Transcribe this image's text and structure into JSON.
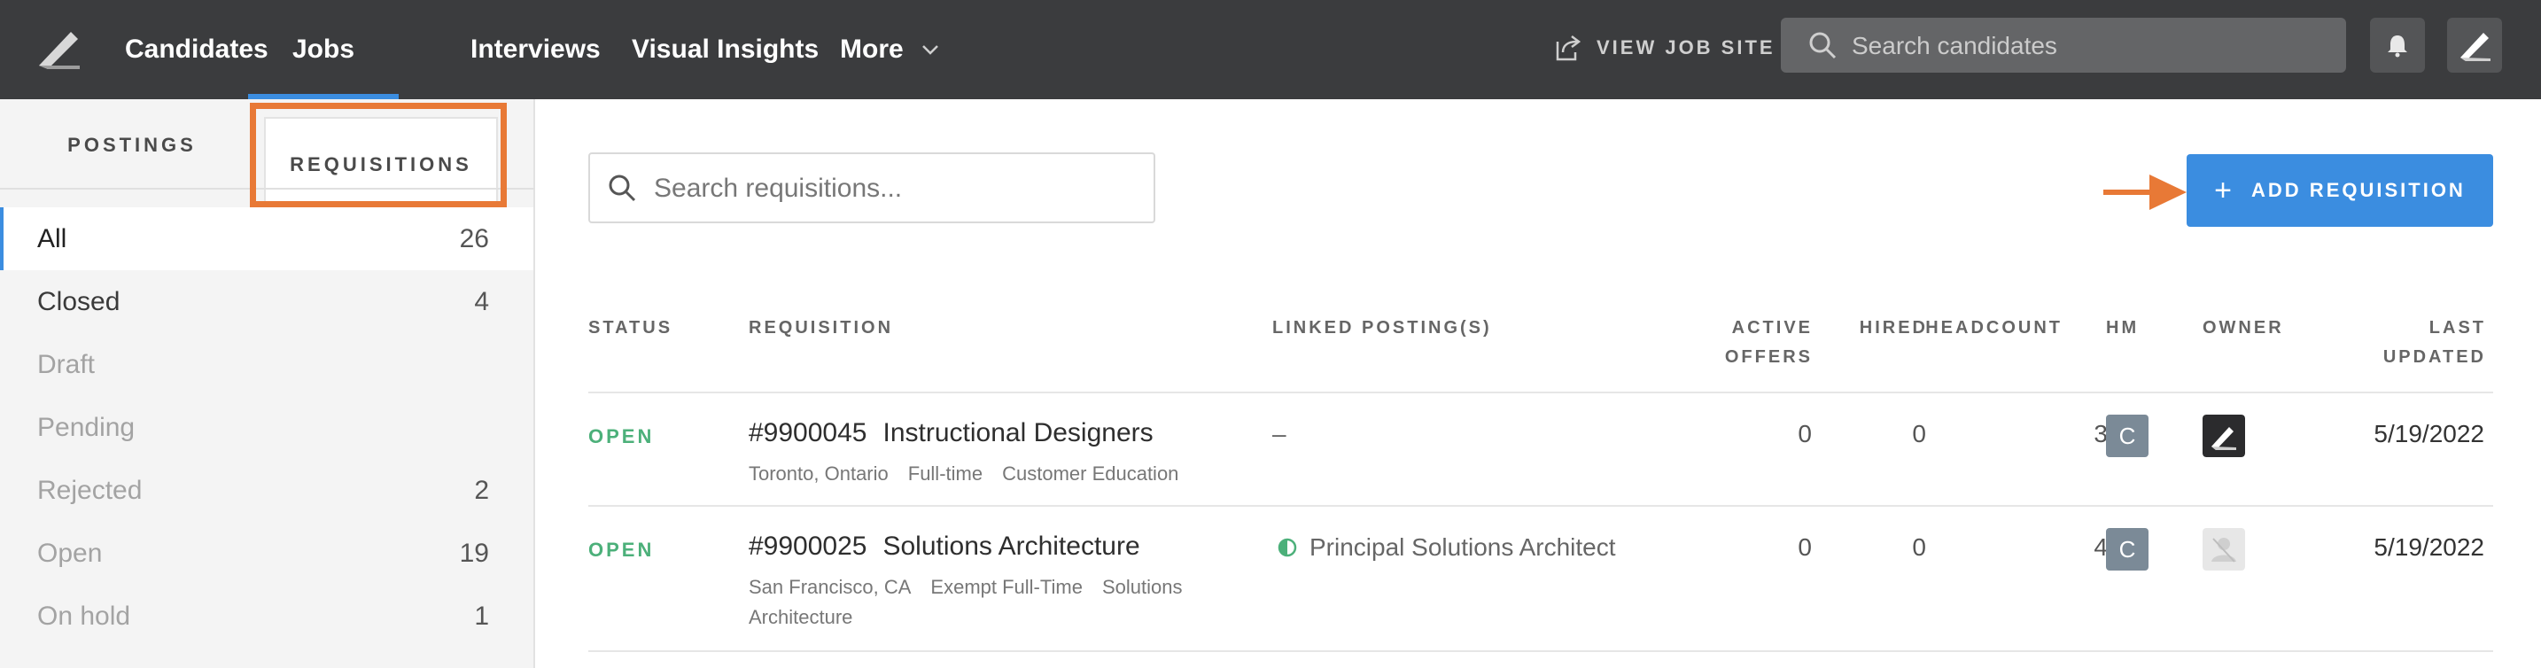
{
  "nav": {
    "items": [
      {
        "label": "Candidates"
      },
      {
        "label": "Jobs"
      },
      {
        "label": "Interviews"
      },
      {
        "label": "Visual Insights"
      },
      {
        "label": "More"
      }
    ],
    "active_item": "Jobs",
    "view_job_site": "VIEW JOB SITE",
    "search_placeholder": "Search candidates"
  },
  "sidebar": {
    "tabs": [
      {
        "label": "POSTINGS"
      },
      {
        "label": "REQUISITIONS"
      }
    ],
    "active_tab": "REQUISITIONS",
    "filters": [
      {
        "label": "All",
        "count": "26"
      },
      {
        "label": "Closed",
        "count": "4"
      },
      {
        "label": "Draft",
        "count": ""
      },
      {
        "label": "Pending",
        "count": ""
      },
      {
        "label": "Rejected",
        "count": "2"
      },
      {
        "label": "Open",
        "count": "19"
      },
      {
        "label": "On hold",
        "count": "1"
      }
    ]
  },
  "main": {
    "search_placeholder": "Search requisitions...",
    "add_button_label": "ADD REQUISITION",
    "table": {
      "headers": {
        "status": "STATUS",
        "requisition": "REQUISITION",
        "linked_postings": "LINKED POSTING(S)",
        "active_offers_1": "ACTIVE",
        "active_offers_2": "OFFERS",
        "hired": "HIRED",
        "headcount": "HEADCOUNT",
        "hm": "HM",
        "owner": "OWNER",
        "last_updated_1": "LAST",
        "last_updated_2": "UPDATED"
      },
      "rows": [
        {
          "status": "OPEN",
          "number": "#9900045",
          "title": "Instructional Designers",
          "meta": [
            "Toronto, Ontario",
            "Full-time",
            "Customer Education"
          ],
          "meta_line2": "",
          "linked_posting": "–",
          "active_offers": "0",
          "hired": "0",
          "headcount": "3",
          "hm": "C",
          "last_updated": "5/19/2022"
        },
        {
          "status": "OPEN",
          "number": "#9900025",
          "title": "Solutions Architecture",
          "meta": [
            "San Francisco, CA",
            "Exempt Full-Time",
            "Solutions"
          ],
          "meta_line2": "Architecture",
          "linked_posting": "Principal Solutions Architect",
          "active_offers": "0",
          "hired": "0",
          "headcount": "4",
          "hm": "C",
          "last_updated": "5/19/2022"
        }
      ]
    }
  },
  "colors": {
    "nav_bg": "#3b3c3e",
    "accent_blue": "#3b8de0",
    "highlight_orange": "#e87936",
    "status_green": "#4cb07a"
  }
}
